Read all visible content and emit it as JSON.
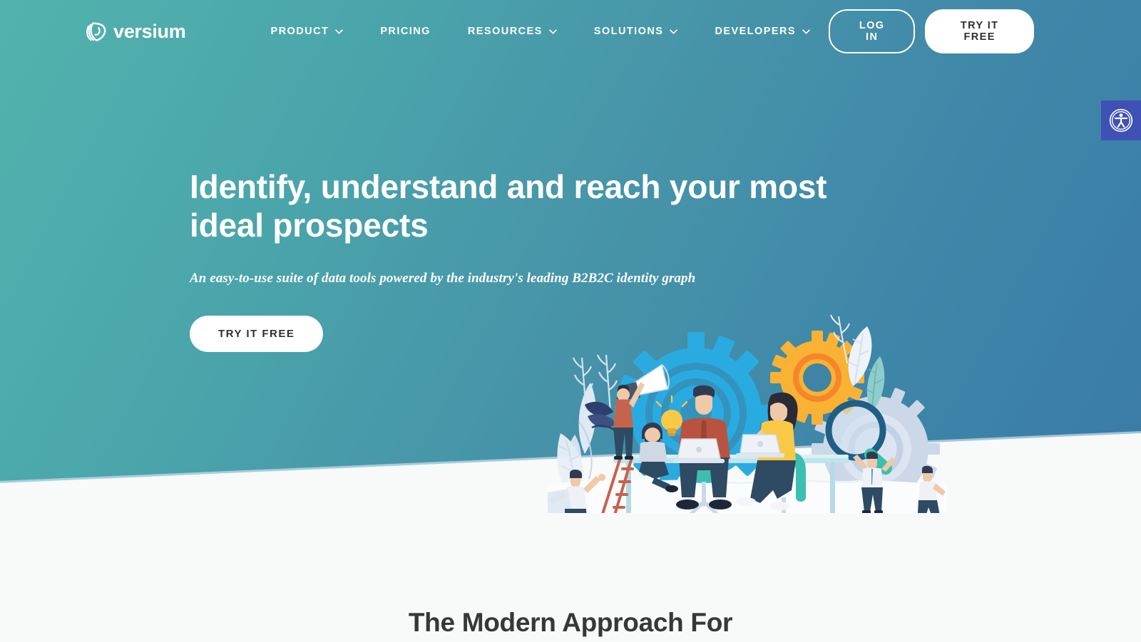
{
  "brand": {
    "name": "versium",
    "logo_icon": "versium-layered-heart-logo"
  },
  "nav": {
    "items": [
      {
        "label": "PRODUCT",
        "has_dropdown": true,
        "icon": "chevron-down-icon"
      },
      {
        "label": "PRICING",
        "has_dropdown": false,
        "icon": ""
      },
      {
        "label": "RESOURCES",
        "has_dropdown": true,
        "icon": "chevron-down-icon"
      },
      {
        "label": "SOLUTIONS",
        "has_dropdown": true,
        "icon": "chevron-down-icon"
      },
      {
        "label": "DEVELOPERS",
        "has_dropdown": true,
        "icon": "chevron-down-icon"
      }
    ],
    "login_label": "LOG IN",
    "try_label": "TRY IT FREE"
  },
  "hero": {
    "title": "Identify, understand and reach your most ideal prospects",
    "subtitle": "An easy-to-use suite of data tools powered by the industry's leading B2B2C identity graph",
    "cta_label": "TRY IT FREE",
    "illustration_name": "team-collaboration-gears-illustration"
  },
  "accessibility": {
    "icon": "accessibility-person-icon",
    "color": "#3f51b5"
  },
  "section_below": {
    "heading": "The Modern Approach For"
  },
  "colors": {
    "gradient_start": "#52b3ad",
    "gradient_end": "#3a7ba6",
    "page_background": "#f8f9f9",
    "text_dark": "#373737",
    "accent_yellow": "#f9b233",
    "accent_cyan": "#29abe2",
    "accent_rust": "#b9533f"
  }
}
